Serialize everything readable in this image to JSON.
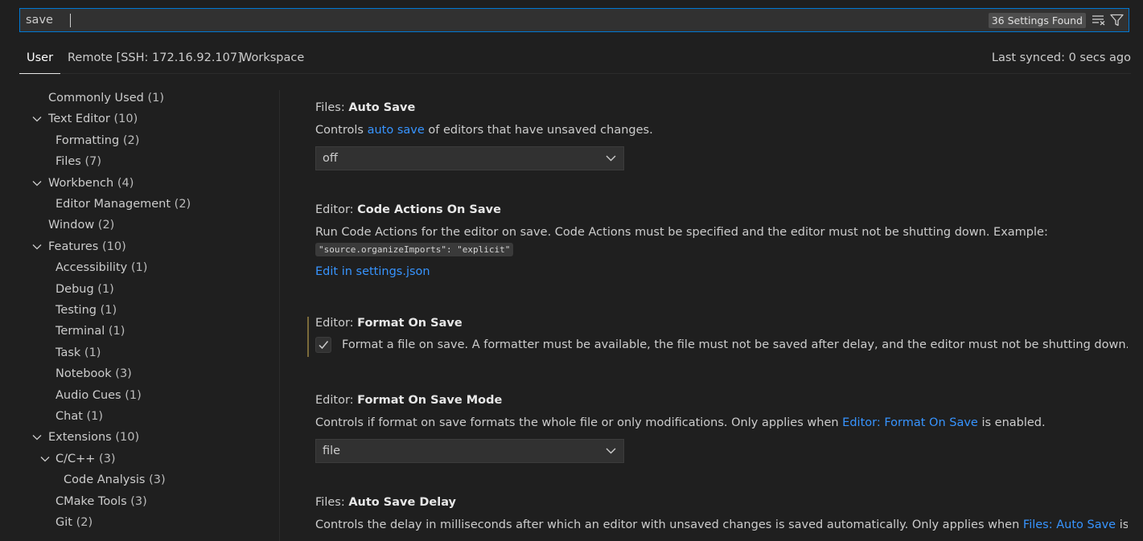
{
  "search": {
    "value": "save",
    "results_badge": "36 Settings Found"
  },
  "tabs": [
    {
      "label": "User"
    },
    {
      "label": "Remote [SSH: 172.16.92.107]"
    },
    {
      "label": "Workspace"
    }
  ],
  "sync_status": "Last synced: 0 secs ago",
  "toc": [
    {
      "label": "Commonly Used",
      "count": "(1)"
    },
    {
      "label": "Text Editor",
      "count": "(10)"
    },
    {
      "label": "Formatting",
      "count": "(2)"
    },
    {
      "label": "Files",
      "count": "(7)"
    },
    {
      "label": "Workbench",
      "count": "(4)"
    },
    {
      "label": "Editor Management",
      "count": "(2)"
    },
    {
      "label": "Window",
      "count": "(2)"
    },
    {
      "label": "Features",
      "count": "(10)"
    },
    {
      "label": "Accessibility",
      "count": "(1)"
    },
    {
      "label": "Debug",
      "count": "(1)"
    },
    {
      "label": "Testing",
      "count": "(1)"
    },
    {
      "label": "Terminal",
      "count": "(1)"
    },
    {
      "label": "Task",
      "count": "(1)"
    },
    {
      "label": "Notebook",
      "count": "(3)"
    },
    {
      "label": "Audio Cues",
      "count": "(1)"
    },
    {
      "label": "Chat",
      "count": "(1)"
    },
    {
      "label": "Extensions",
      "count": "(10)"
    },
    {
      "label": "C/C++",
      "count": "(3)"
    },
    {
      "label": "Code Analysis",
      "count": "(3)"
    },
    {
      "label": "CMake Tools",
      "count": "(3)"
    },
    {
      "label": "Git",
      "count": "(2)"
    }
  ],
  "settings": {
    "auto_save": {
      "category": "Files: ",
      "name": "Auto Save",
      "desc_pre": "Controls ",
      "desc_link": "auto save",
      "desc_post": " of editors that have unsaved changes.",
      "value": "off"
    },
    "code_actions": {
      "category": "Editor: ",
      "name": "Code Actions On Save",
      "desc": "Run Code Actions for the editor on save. Code Actions must be specified and the editor must not be shutting down. Example:",
      "code": "\"source.organizeImports\": \"explicit\"",
      "edit_link": "Edit in settings.json"
    },
    "format_on_save": {
      "category": "Editor: ",
      "name": "Format On Save",
      "checked": true,
      "desc": "Format a file on save. A formatter must be available, the file must not be saved after delay, and the editor must not be shutting down."
    },
    "format_on_save_mode": {
      "category": "Editor: ",
      "name": "Format On Save Mode",
      "desc_pre": "Controls if format on save formats the whole file or only modifications. Only applies when ",
      "desc_link": "Editor: Format On Save",
      "desc_post": " is enabled.",
      "value": "file"
    },
    "auto_save_delay": {
      "category": "Files: ",
      "name": "Auto Save Delay",
      "desc_pre": "Controls the delay in milliseconds after which an editor with unsaved changes is saved automatically. Only applies when ",
      "desc_link": "Files: Auto Save",
      "desc_post": " is set to"
    }
  }
}
